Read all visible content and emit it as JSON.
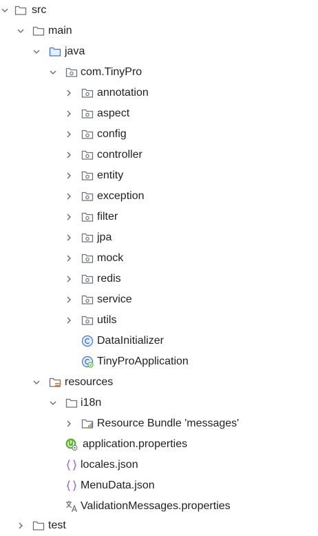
{
  "tree": {
    "src": "src",
    "main": "main",
    "java": "java",
    "package": "com.TinyPro",
    "packages": {
      "annotation": "annotation",
      "aspect": "aspect",
      "config": "config",
      "controller": "controller",
      "entity": "entity",
      "exception": "exception",
      "filter": "filter",
      "jpa": "jpa",
      "mock": "mock",
      "redis": "redis",
      "service": "service",
      "utils": "utils"
    },
    "classes": {
      "data_initializer": "DataInitializer",
      "app": "TinyProApplication"
    },
    "resources": "resources",
    "i18n": "i18n",
    "bundle": "Resource Bundle 'messages'",
    "files": {
      "app_props": "application.properties",
      "locales": "locales.json",
      "menu": "MenuData.json",
      "validation": "ValidationMessages.properties"
    },
    "test": "test"
  },
  "icons": {
    "folder": "folder-icon",
    "package": "package-icon",
    "resources_folder": "resources-folder-icon",
    "bundle": "resource-bundle-icon",
    "class": "class-icon",
    "spring_app": "spring-application-class-icon",
    "spring_props": "spring-properties-icon",
    "json": "json-icon",
    "i18n_props": "translation-properties-icon",
    "chevron_down": "chevron-down-icon",
    "chevron_right": "chevron-right-icon"
  },
  "colors": {
    "folder_stroke": "#6c707e",
    "java_folder": "#3574f0",
    "class_blue": "#3574f0",
    "spring_green": "#5fb832",
    "json_purple": "#9c6ade",
    "resources_orange": "#e8772e"
  }
}
